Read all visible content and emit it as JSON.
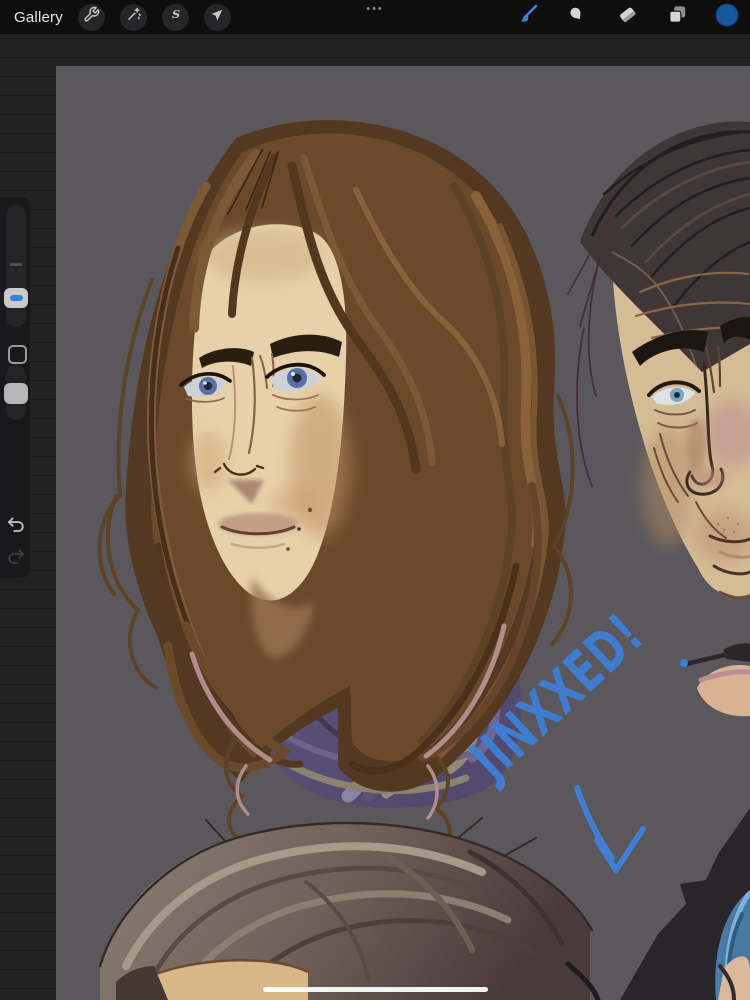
{
  "topbar": {
    "gallery_label": "Gallery",
    "multitask_indicator": "•••",
    "left_tools": [
      {
        "label": "Actions",
        "icon": "wrench-icon"
      },
      {
        "label": "Adjustments",
        "icon": "magic-wand-icon"
      },
      {
        "label": "Selection",
        "icon": "selection-s-icon",
        "glyph": "S"
      },
      {
        "label": "Transform",
        "icon": "transform-arrow-icon"
      }
    ],
    "right_tools": [
      {
        "label": "Paint",
        "icon": "brush-icon",
        "active": true
      },
      {
        "label": "Smudge",
        "icon": "smudge-icon",
        "active": false
      },
      {
        "label": "Erase",
        "icon": "eraser-icon",
        "active": false
      },
      {
        "label": "Layers",
        "icon": "layers-icon",
        "active": false
      },
      {
        "label": "Color",
        "icon": "color-swatch",
        "swatch_color": "#15589c"
      }
    ],
    "bg_color": "#0e0e0f",
    "icon_color": "#c9c9c9",
    "active_color": "#3c80d8"
  },
  "sidebar": {
    "brush_size_slider": {
      "handle": "active-blue"
    },
    "opacity_slider": {
      "handle": "gray"
    },
    "modify_button": "square",
    "undo": "visible",
    "redo": "dimmed",
    "accent_color": "#3c80d8"
  },
  "canvas": {
    "bg_color": "#5a585c",
    "annotation": {
      "text": "JINXXED!",
      "color": "#3f7ed3",
      "rotation_deg": -43,
      "arrow_direction": "down-right"
    },
    "artwork_subjects": [
      "portrait with long wavy brown hair and purple striped scarf",
      "dark slicked-hair older man, top right, cropped",
      "wavy gray-brown haired head, bottom left, cropped",
      "dark figure with blue hair strands, bottom right corner"
    ]
  },
  "home_indicator": true
}
